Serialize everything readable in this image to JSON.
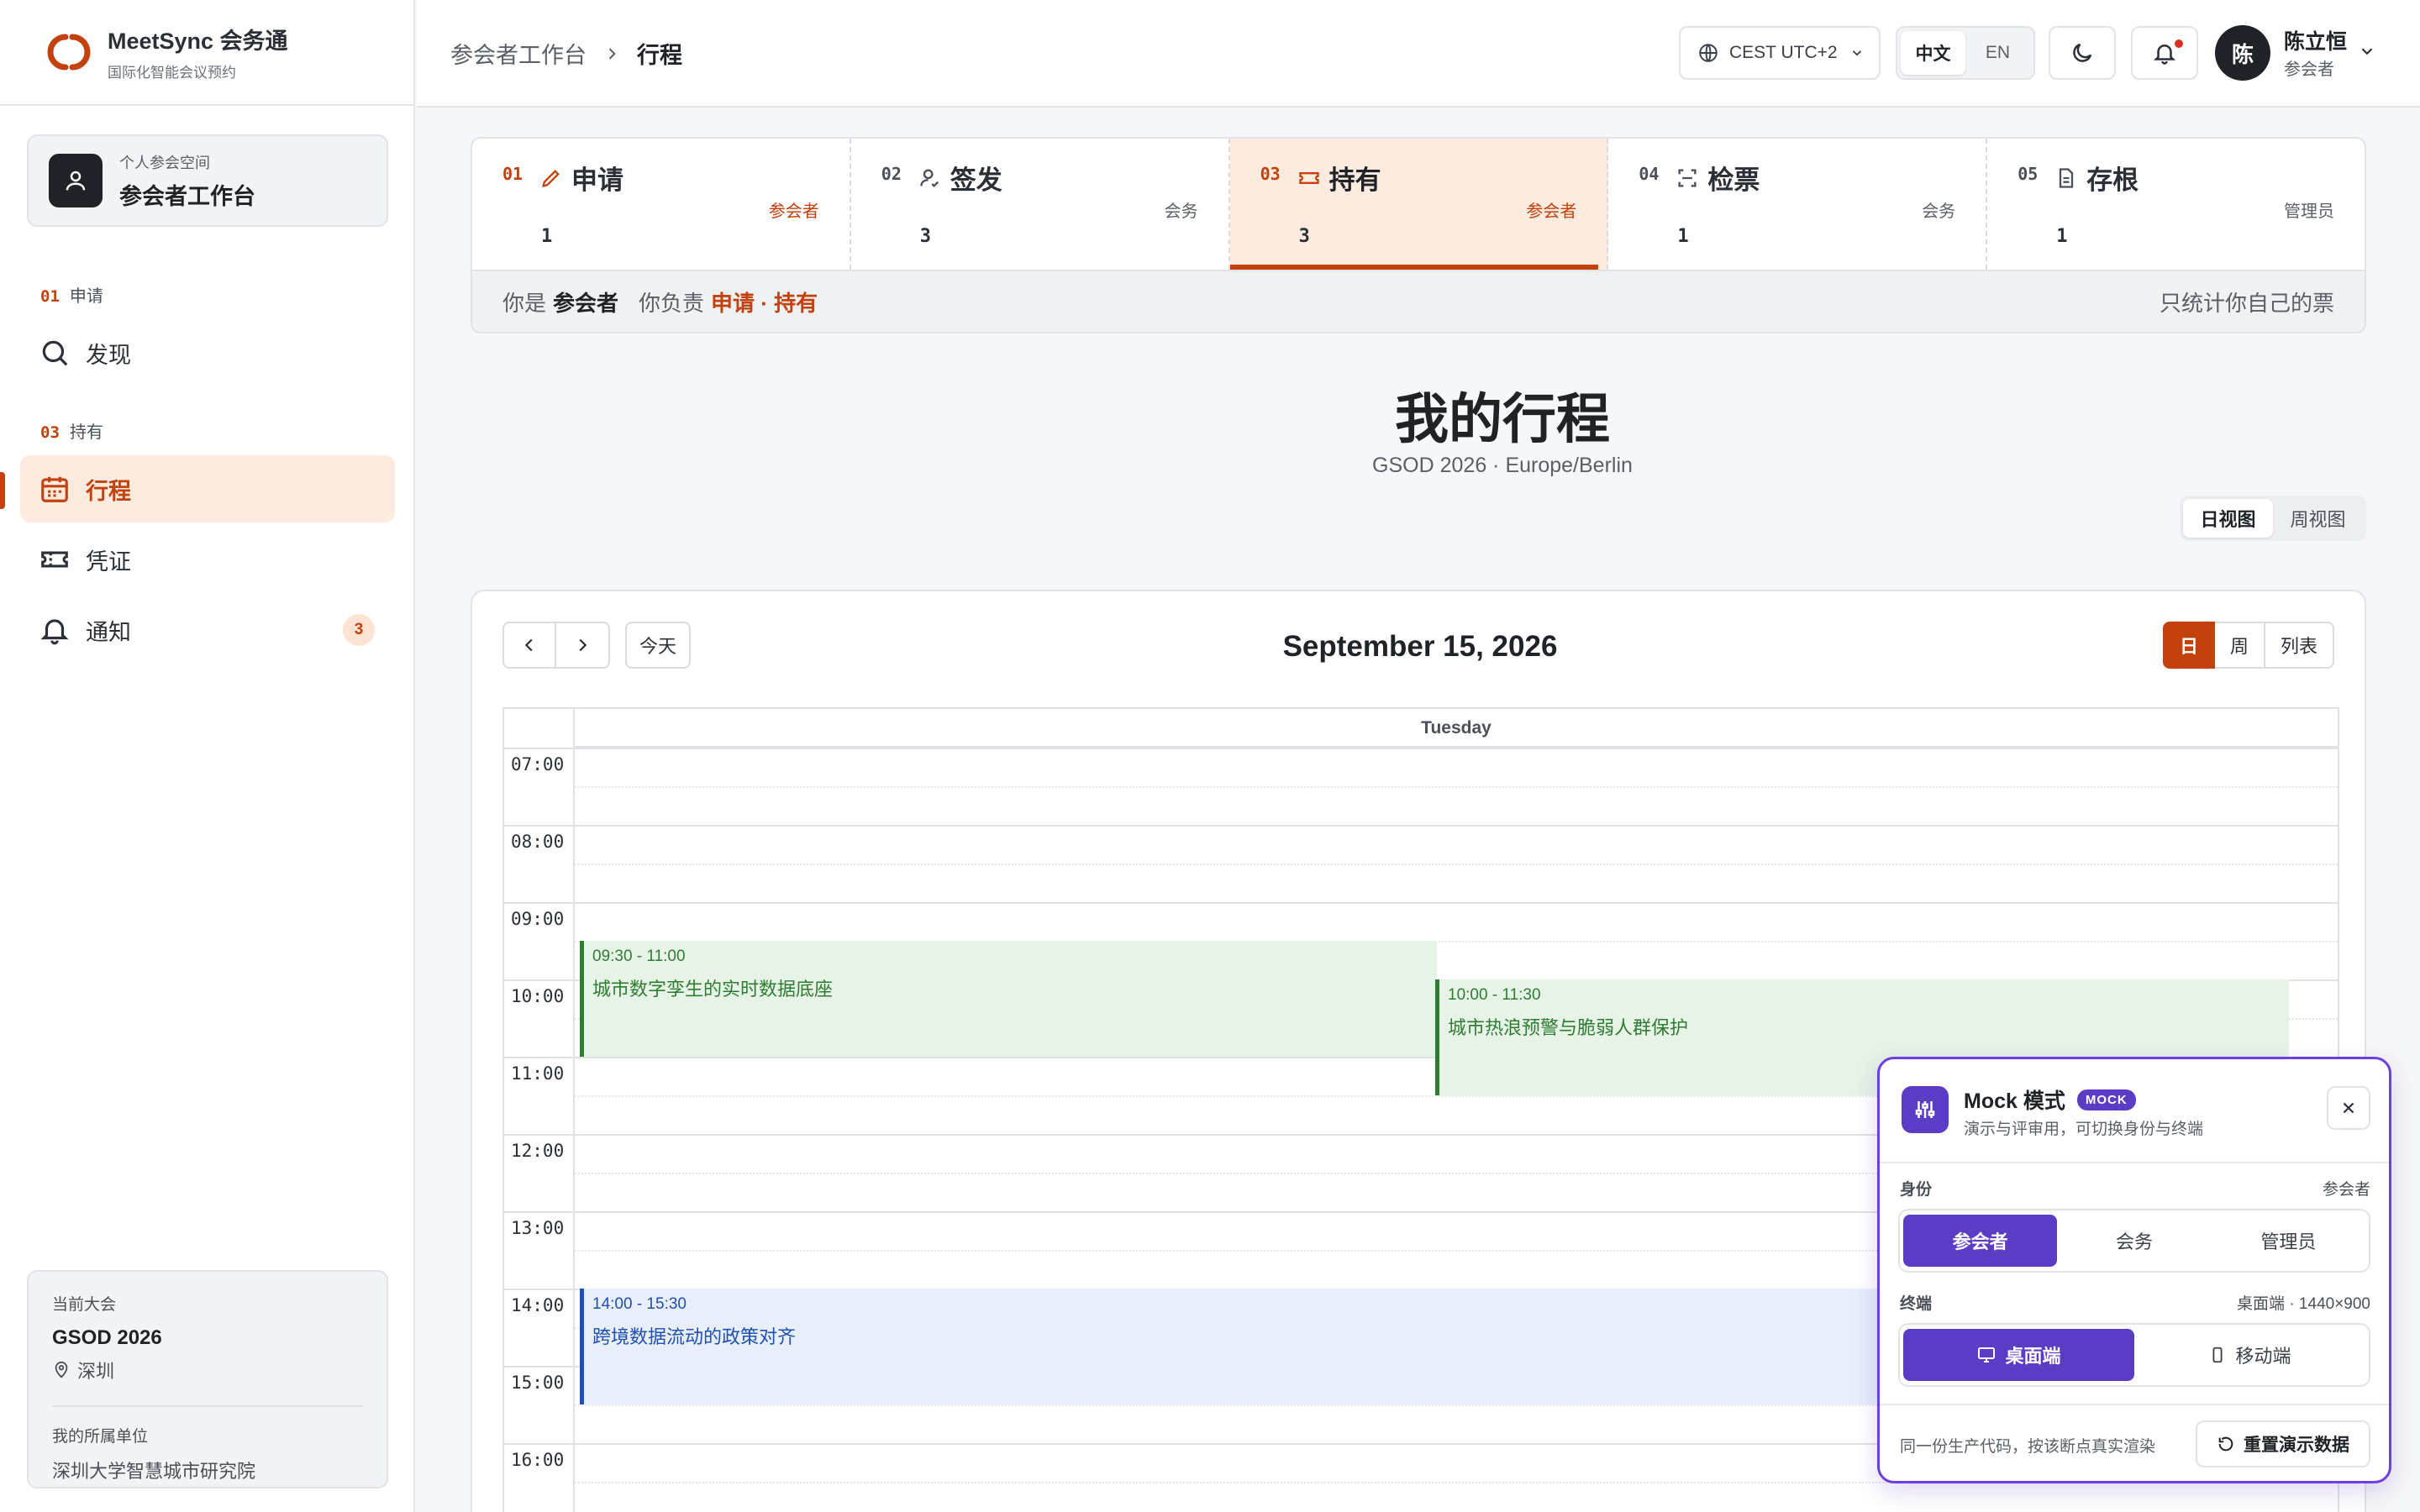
{
  "brand": {
    "name": "MeetSync 会务通",
    "tagline": "国际化智能会议预约"
  },
  "workspace": {
    "label": "个人参会空间",
    "title": "参会者工作台"
  },
  "sidebar": {
    "sections": [
      {
        "num": "01",
        "label": "申请"
      },
      {
        "num": "03",
        "label": "持有"
      }
    ],
    "items": [
      {
        "label": "发现",
        "icon": "search-icon"
      },
      {
        "label": "行程",
        "icon": "calendar-icon",
        "active": true
      },
      {
        "label": "凭证",
        "icon": "ticket-icon"
      },
      {
        "label": "通知",
        "icon": "bell-icon",
        "badge": "3"
      }
    ]
  },
  "conference": {
    "label": "当前大会",
    "name": "GSOD 2026",
    "city": "深圳",
    "org_label": "我的所属单位",
    "org": "深圳大学智慧城市研究院"
  },
  "header": {
    "breadcrumb_parent": "参会者工作台",
    "breadcrumb_current": "行程",
    "timezone": "CEST UTC+2",
    "lang_zh": "中文",
    "lang_en": "EN",
    "user_initial": "陈",
    "user_name": "陈立恒",
    "user_role": "参会者"
  },
  "stages": [
    {
      "num": "01",
      "title": "申请",
      "icon": "pencil-icon",
      "role": "参会者",
      "count": "1",
      "mine": true
    },
    {
      "num": "02",
      "title": "签发",
      "icon": "user-check-icon",
      "role": "会务",
      "count": "3"
    },
    {
      "num": "03",
      "title": "持有",
      "icon": "ticket-icon",
      "role": "参会者",
      "count": "3",
      "mine": true,
      "active": true
    },
    {
      "num": "04",
      "title": "检票",
      "icon": "scan-icon",
      "role": "会务",
      "count": "1"
    },
    {
      "num": "05",
      "title": "存根",
      "icon": "file-icon",
      "role": "管理员",
      "count": "1"
    }
  ],
  "role_strip": {
    "you_are": "你是",
    "role": "参会者",
    "you_handle": "你负责",
    "duties": "申请 · 持有",
    "note": "只统计你自己的票"
  },
  "page": {
    "title": "我的行程",
    "subtitle": "GSOD 2026 · Europe/Berlin",
    "view_day": "日视图",
    "view_week": "周视图"
  },
  "calendar": {
    "date": "September 15, 2026",
    "today": "今天",
    "mode_day": "日",
    "mode_week": "周",
    "mode_list": "列表",
    "weekday": "Tuesday",
    "hours": [
      "07:00",
      "08:00",
      "09:00",
      "10:00",
      "11:00",
      "12:00",
      "13:00",
      "14:00",
      "15:00",
      "16:00"
    ],
    "events": [
      {
        "time": "09:30 - 11:00",
        "title": "城市数字孪生的实时数据底座",
        "color": "green"
      },
      {
        "time": "10:00 - 11:30",
        "title": "城市热浪预警与脆弱人群保护",
        "color": "green"
      },
      {
        "time": "14:00 - 15:30",
        "title": "跨境数据流动的政策对齐",
        "color": "blue"
      }
    ]
  },
  "mock": {
    "title": "Mock 模式",
    "tag": "MOCK",
    "subtitle": "演示与评审用，可切换身份与终端",
    "identity_label": "身份",
    "identity_value": "参会者",
    "identities": [
      "参会者",
      "会务",
      "管理员"
    ],
    "terminal_label": "终端",
    "terminal_value": "桌面端 · 1440×900",
    "terminals": [
      "桌面端",
      "移动端"
    ],
    "footer": "同一份生产代码，按该断点真实渲染",
    "reset": "重置演示数据"
  },
  "colors": {
    "accent": "#c2410c",
    "mock_purple": "#5b3cc4",
    "event_green": "#2e7d32",
    "event_blue": "#1e4fb3"
  }
}
